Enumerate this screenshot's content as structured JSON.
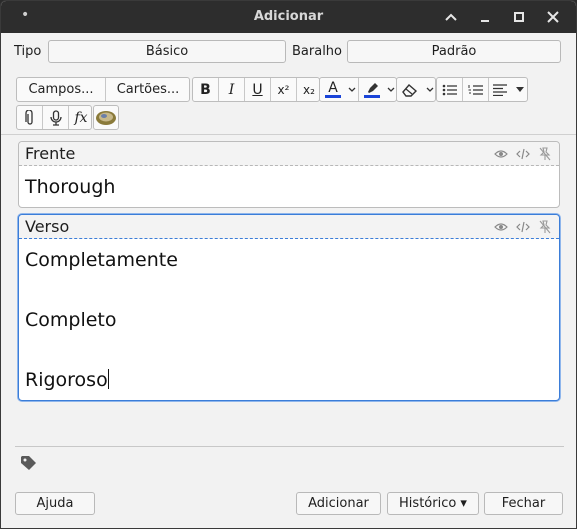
{
  "window": {
    "title": "Adicionar",
    "menu_dot": "•"
  },
  "type_row": {
    "tipo_label": "Tipo",
    "tipo_value": "Básico",
    "baralho_label": "Baralho",
    "baralho_value": "Padrão"
  },
  "toolbar": {
    "campos": "Campos...",
    "cartoes": "Cartões...",
    "bold": "B",
    "italic": "I",
    "underline": "U",
    "superscript": "x²",
    "subscript": "x₂",
    "text_color_glyph": "A",
    "text_color": "#1a44d8",
    "highlight_color": "#1a44d8",
    "fx": "fx"
  },
  "fields": [
    {
      "name": "Frente",
      "lines": [
        "Thorough"
      ]
    },
    {
      "name": "Verso",
      "lines": [
        "Completamente",
        "Completo",
        "Rigoroso"
      ]
    }
  ],
  "footer": {
    "help": "Ajuda",
    "add": "Adicionar",
    "history": "Histórico ▾",
    "close": "Fechar"
  }
}
